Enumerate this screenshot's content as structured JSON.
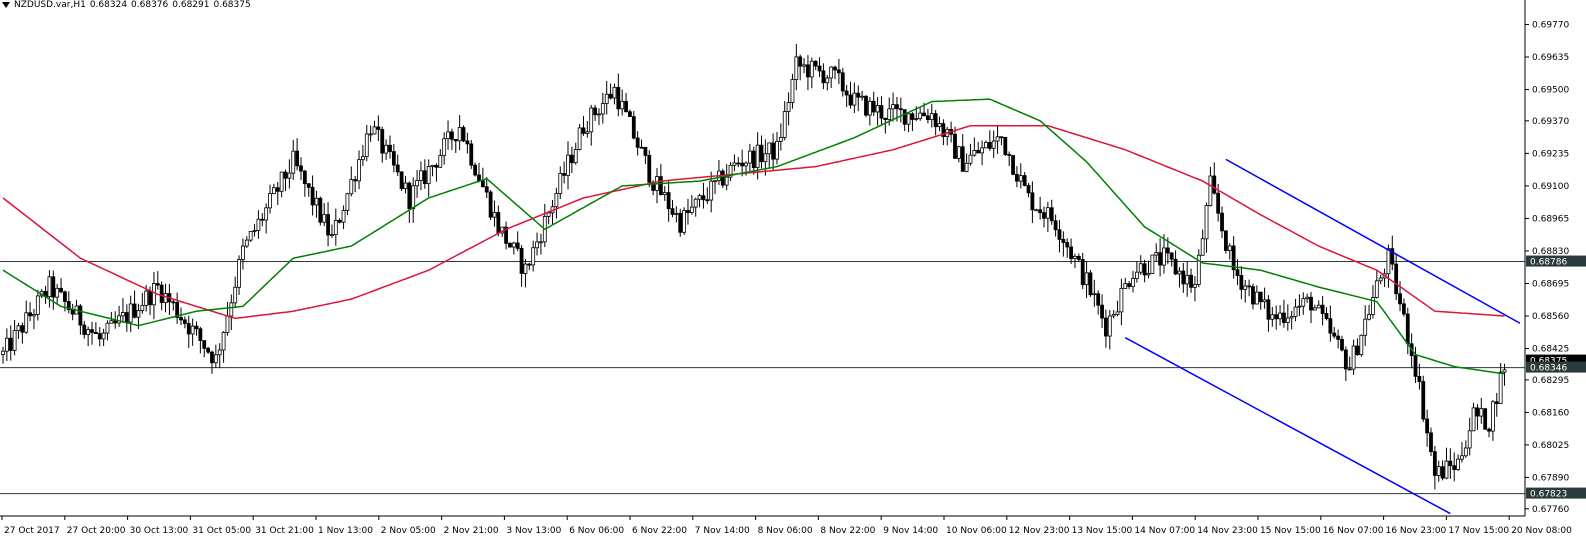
{
  "header": {
    "symbol": "NZDUSD.var,H1",
    "open": "0.68324",
    "high": "0.68376",
    "low": "0.68291",
    "close": "0.68375"
  },
  "price_axis": {
    "labels": [
      "0.69770",
      "0.69635",
      "0.69500",
      "0.69370",
      "0.69235",
      "0.69100",
      "0.68965",
      "0.68830",
      "0.68695",
      "0.68560",
      "0.68425",
      "0.68295",
      "0.68160",
      "0.68025",
      "0.67890",
      "0.67760"
    ],
    "min": 0.6773,
    "max": 0.6983
  },
  "markers": [
    {
      "value": 0.68786,
      "label": "0.68786",
      "bg": "#2b3a3a"
    },
    {
      "value": 0.68375,
      "label": "0.68375",
      "bg": "#000000"
    },
    {
      "value": 0.68346,
      "label": "0.68346",
      "bg": "#2b3a3a"
    },
    {
      "value": 0.67823,
      "label": "0.67823",
      "bg": "#2b3a3a"
    }
  ],
  "time_axis": {
    "labels": [
      "27 Oct 2017",
      "27 Oct 20:00",
      "30 Oct 13:00",
      "31 Oct 05:00",
      "31 Oct 21:00",
      "1 Nov 13:00",
      "2 Nov 05:00",
      "2 Nov 21:00",
      "3 Nov 13:00",
      "6 Nov 06:00",
      "6 Nov 22:00",
      "7 Nov 14:00",
      "8 Nov 06:00",
      "8 Nov 22:00",
      "9 Nov 14:00",
      "10 Nov 06:00",
      "12 Nov 23:00",
      "13 Nov 15:00",
      "14 Nov 07:00",
      "14 Nov 23:00",
      "15 Nov 15:00",
      "16 Nov 07:00",
      "16 Nov 23:00",
      "17 Nov 15:00",
      "20 Nov 08:00"
    ]
  },
  "colors": {
    "background": "#ffffff",
    "candle": "#000000",
    "ma_fast": "#008000",
    "ma_slow": "#dc143c",
    "channel": "#0000ff",
    "hline": "#2b3a3a",
    "axis": "#000000"
  },
  "chart_data": {
    "type": "candlestick",
    "symbol": "NZDUSD.var",
    "timeframe": "H1",
    "key_points": [
      {
        "bar": 0,
        "price": 0.684
      },
      {
        "bar": 12,
        "price": 0.6868
      },
      {
        "bar": 25,
        "price": 0.6846
      },
      {
        "bar": 40,
        "price": 0.6868
      },
      {
        "bar": 55,
        "price": 0.6838
      },
      {
        "bar": 62,
        "price": 0.6883
      },
      {
        "bar": 75,
        "price": 0.692
      },
      {
        "bar": 85,
        "price": 0.6888
      },
      {
        "bar": 95,
        "price": 0.6935
      },
      {
        "bar": 105,
        "price": 0.6905
      },
      {
        "bar": 118,
        "price": 0.6935
      },
      {
        "bar": 128,
        "price": 0.6893
      },
      {
        "bar": 135,
        "price": 0.6875
      },
      {
        "bar": 150,
        "price": 0.6935
      },
      {
        "bar": 158,
        "price": 0.695
      },
      {
        "bar": 168,
        "price": 0.6912
      },
      {
        "bar": 175,
        "price": 0.6895
      },
      {
        "bar": 190,
        "price": 0.692
      },
      {
        "bar": 200,
        "price": 0.6925
      },
      {
        "bar": 205,
        "price": 0.696
      },
      {
        "bar": 215,
        "price": 0.6955
      },
      {
        "bar": 220,
        "price": 0.6945
      },
      {
        "bar": 228,
        "price": 0.694
      },
      {
        "bar": 240,
        "price": 0.694
      },
      {
        "bar": 248,
        "price": 0.692
      },
      {
        "bar": 258,
        "price": 0.693
      },
      {
        "bar": 265,
        "price": 0.6905
      },
      {
        "bar": 272,
        "price": 0.6895
      },
      {
        "bar": 280,
        "price": 0.687
      },
      {
        "bar": 285,
        "price": 0.6852
      },
      {
        "bar": 292,
        "price": 0.6875
      },
      {
        "bar": 300,
        "price": 0.688
      },
      {
        "bar": 308,
        "price": 0.6868
      },
      {
        "bar": 312,
        "price": 0.691
      },
      {
        "bar": 318,
        "price": 0.6875
      },
      {
        "bar": 328,
        "price": 0.6855
      },
      {
        "bar": 338,
        "price": 0.6862
      },
      {
        "bar": 348,
        "price": 0.6835
      },
      {
        "bar": 355,
        "price": 0.6868
      },
      {
        "bar": 358,
        "price": 0.688
      },
      {
        "bar": 365,
        "price": 0.6835
      },
      {
        "bar": 370,
        "price": 0.679
      },
      {
        "bar": 376,
        "price": 0.6795
      },
      {
        "bar": 380,
        "price": 0.6815
      },
      {
        "bar": 384,
        "price": 0.6812
      },
      {
        "bar": 388,
        "price": 0.6836
      }
    ],
    "ma_fast_points": [
      {
        "bar": 0,
        "price": 0.6875
      },
      {
        "bar": 15,
        "price": 0.686
      },
      {
        "bar": 35,
        "price": 0.6852
      },
      {
        "bar": 50,
        "price": 0.6858
      },
      {
        "bar": 62,
        "price": 0.686
      },
      {
        "bar": 75,
        "price": 0.688
      },
      {
        "bar": 90,
        "price": 0.6885
      },
      {
        "bar": 110,
        "price": 0.6905
      },
      {
        "bar": 125,
        "price": 0.6913
      },
      {
        "bar": 140,
        "price": 0.6892
      },
      {
        "bar": 160,
        "price": 0.691
      },
      {
        "bar": 180,
        "price": 0.6912
      },
      {
        "bar": 200,
        "price": 0.6918
      },
      {
        "bar": 220,
        "price": 0.693
      },
      {
        "bar": 240,
        "price": 0.6945
      },
      {
        "bar": 255,
        "price": 0.6946
      },
      {
        "bar": 268,
        "price": 0.6937
      },
      {
        "bar": 280,
        "price": 0.692
      },
      {
        "bar": 295,
        "price": 0.6893
      },
      {
        "bar": 310,
        "price": 0.6878
      },
      {
        "bar": 325,
        "price": 0.6875
      },
      {
        "bar": 340,
        "price": 0.6868
      },
      {
        "bar": 355,
        "price": 0.6862
      },
      {
        "bar": 365,
        "price": 0.684
      },
      {
        "bar": 375,
        "price": 0.6835
      },
      {
        "bar": 388,
        "price": 0.6832
      }
    ],
    "ma_slow_points": [
      {
        "bar": 0,
        "price": 0.6905
      },
      {
        "bar": 20,
        "price": 0.688
      },
      {
        "bar": 40,
        "price": 0.6865
      },
      {
        "bar": 60,
        "price": 0.6855
      },
      {
        "bar": 75,
        "price": 0.6858
      },
      {
        "bar": 90,
        "price": 0.6863
      },
      {
        "bar": 110,
        "price": 0.6875
      },
      {
        "bar": 130,
        "price": 0.6892
      },
      {
        "bar": 150,
        "price": 0.6905
      },
      {
        "bar": 170,
        "price": 0.6912
      },
      {
        "bar": 190,
        "price": 0.6915
      },
      {
        "bar": 210,
        "price": 0.6918
      },
      {
        "bar": 230,
        "price": 0.6925
      },
      {
        "bar": 250,
        "price": 0.6935
      },
      {
        "bar": 270,
        "price": 0.6935
      },
      {
        "bar": 290,
        "price": 0.6925
      },
      {
        "bar": 310,
        "price": 0.6912
      },
      {
        "bar": 325,
        "price": 0.6898
      },
      {
        "bar": 340,
        "price": 0.6885
      },
      {
        "bar": 355,
        "price": 0.6875
      },
      {
        "bar": 370,
        "price": 0.6858
      },
      {
        "bar": 388,
        "price": 0.6856
      }
    ],
    "channel_lines": [
      {
        "x1_bar": 316,
        "y1": 0.6921,
        "x2_bar": 392,
        "y2": 0.6853
      },
      {
        "x1_bar": 290,
        "y1": 0.6847,
        "x2_bar": 374,
        "y2": 0.6774
      }
    ],
    "hlines": [
      0.68786,
      0.68346,
      0.67823
    ]
  }
}
